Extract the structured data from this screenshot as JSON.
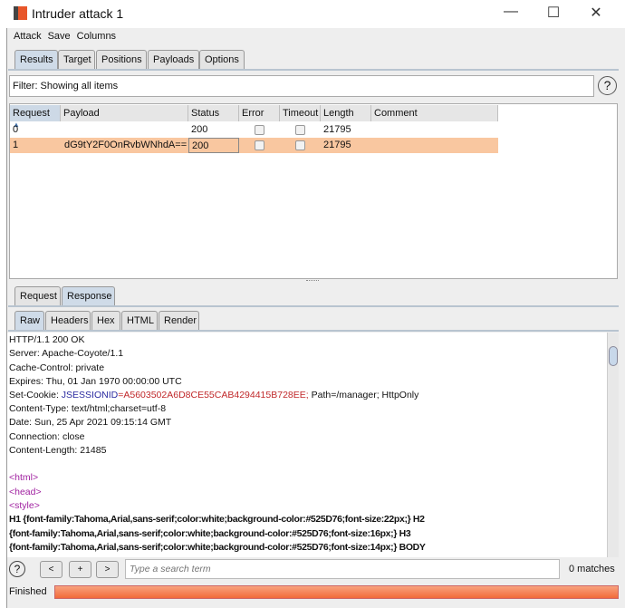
{
  "window": {
    "title": "Intruder attack 1",
    "controls": [
      "minimize",
      "maximize",
      "close"
    ]
  },
  "menu": [
    "Attack",
    "Save",
    "Columns"
  ],
  "tabs": [
    "Results",
    "Target",
    "Positions",
    "Payloads",
    "Options"
  ],
  "filter": "Filter: Showing all items",
  "table": {
    "columns": [
      "Request",
      "Payload",
      "Status",
      "Error",
      "Timeout",
      "Length",
      "Comment"
    ],
    "rows": [
      {
        "request": "0",
        "payload": "",
        "status": "200",
        "error": false,
        "timeout": false,
        "length": "21795",
        "comment": ""
      },
      {
        "request": "1",
        "payload": "dG9tY2F0OnRvbWNhdA==",
        "status": "200",
        "error": false,
        "timeout": false,
        "length": "21795",
        "comment": "",
        "selected": true
      }
    ]
  },
  "reqresp_tabs": [
    "Request",
    "Response"
  ],
  "view_tabs": [
    "Raw",
    "Headers",
    "Hex",
    "HTML",
    "Render"
  ],
  "response": {
    "headers": [
      "HTTP/1.1 200 OK",
      "Server: Apache-Coyote/1.1",
      "Cache-Control: private",
      "Expires: Thu, 01 Jan 1970 00:00:00 UTC"
    ],
    "cookie": {
      "prefix": "Set-Cookie: ",
      "name": "JSESSIONID",
      "value": "=A5603502A6D8CE55CAB4294415B728EE;",
      "suffix": " Path=/manager; HttpOnly"
    },
    "headers2": [
      "Content-Type: text/html;charset=utf-8",
      "Date: Sun, 25 Apr 2021 09:15:14 GMT",
      "Connection: close",
      "Content-Length: 21485"
    ],
    "tags": [
      "<html>",
      "<head>",
      "<style>"
    ],
    "css": [
      "H1 {font-family:Tahoma,Arial,sans-serif;color:white;background-color:#525D76;font-size:22px;} H2",
      "{font-family:Tahoma,Arial,sans-serif;color:white;background-color:#525D76;font-size:16px;} H3",
      "{font-family:Tahoma,Arial,sans-serif;color:white;background-color:#525D76;font-size:14px;} BODY"
    ]
  },
  "search": {
    "prev": "<",
    "add": "+",
    "next": ">",
    "placeholder": "Type a search term",
    "matches": "0 matches"
  },
  "status": {
    "text": "Finished",
    "progress": 1.0
  },
  "colors": {
    "selected_row": "#f9c7a0",
    "progress": "#f26b3a",
    "cookie_name": "#2a2aa0",
    "cookie_value": "#c0282a",
    "tag": "#a020a0"
  }
}
